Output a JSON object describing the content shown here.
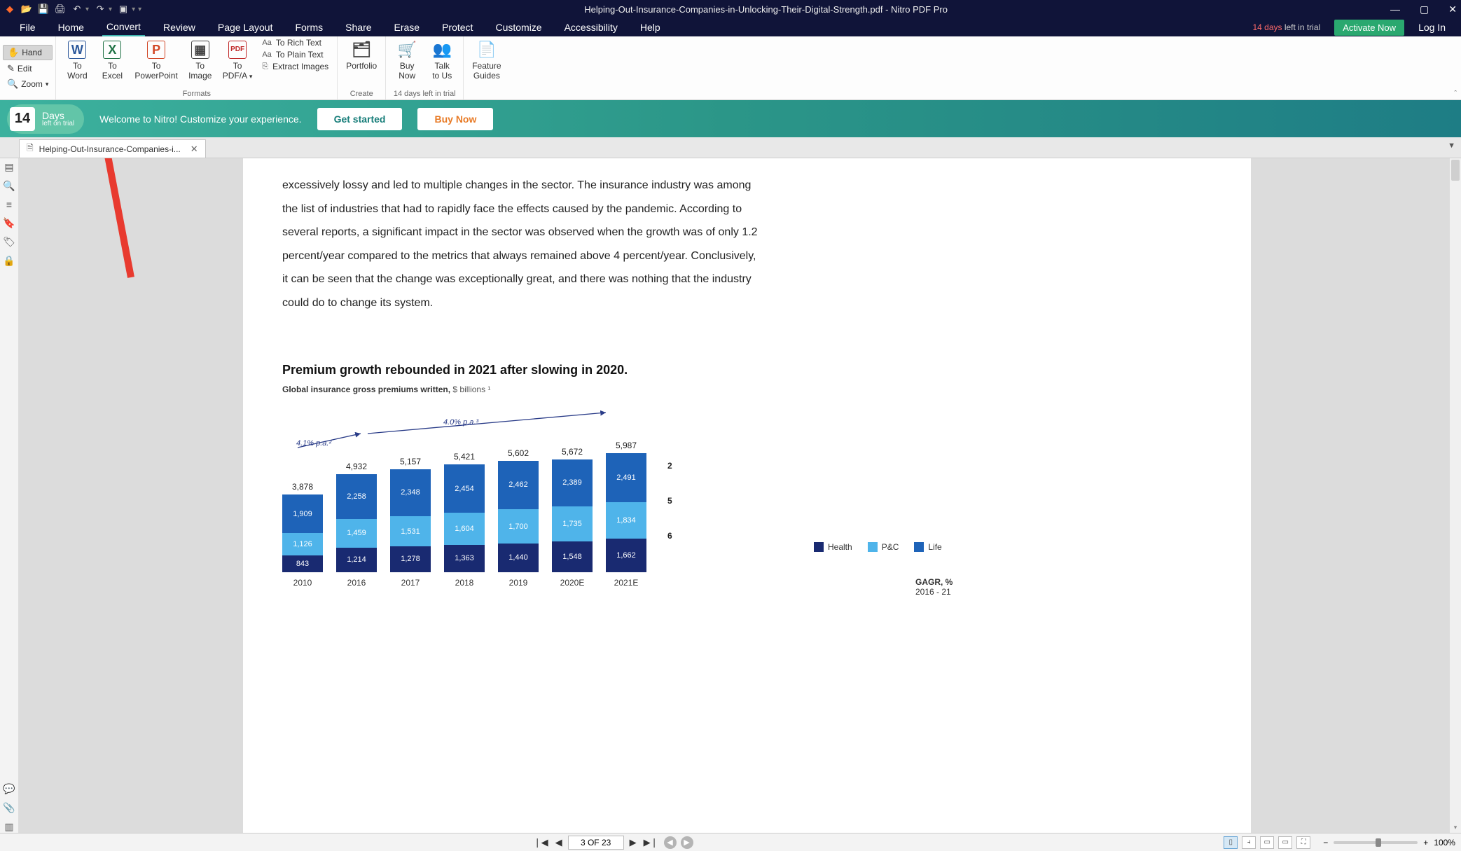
{
  "title_bar": {
    "doc_title": "Helping-Out-Insurance-Companies-in-Unlocking-Their-Digital-Strength.pdf - Nitro PDF Pro"
  },
  "menu": {
    "items": [
      "File",
      "Home",
      "Convert",
      "Review",
      "Page Layout",
      "Forms",
      "Share",
      "Erase",
      "Protect",
      "Customize",
      "Accessibility",
      "Help"
    ],
    "active": "Convert",
    "trial_days": "14 days",
    "trial_suffix": " left in trial",
    "activate": "Activate Now",
    "login": "Log In"
  },
  "ribbon": {
    "tools": {
      "hand": "Hand",
      "edit": "Edit",
      "zoom": "Zoom"
    },
    "convert": {
      "to_word": "To\nWord",
      "to_excel": "To\nExcel",
      "to_ppt": "To\nPowerPoint",
      "to_image": "To\nImage",
      "to_pdfa": "To\nPDF/A",
      "caption": "Formats",
      "rich": "To Rich Text",
      "plain": "To Plain Text",
      "extract": "Extract Images"
    },
    "create": {
      "portfolio": "Portfolio",
      "caption": "Create"
    },
    "trial_group": {
      "buy": "Buy\nNow",
      "talk": "Talk\nto Us",
      "caption": "14 days left in trial"
    },
    "guides": {
      "feature": "Feature\nGuides"
    }
  },
  "banner": {
    "days_num": "14",
    "days_label": "Days",
    "days_sub": "left on trial",
    "message": "Welcome to Nitro! Customize your experience.",
    "get_started": "Get started",
    "buy_now": "Buy Now"
  },
  "doc_tab": {
    "label": "Helping-Out-Insurance-Companies-i..."
  },
  "page_body": "excessively lossy and led to multiple changes in the sector. The insurance industry was among the list of industries that had to rapidly face the effects caused by the pandemic. According to several reports, a significant impact in the sector was observed when the growth was of only 1.2 percent/year compared to the metrics that always remained above 4 percent/year. Conclusively, it can be seen that the change was exceptionally great, and there was nothing that the industry could do to change its system.",
  "chart_title": "Premium growth rebounded in 2021 after slowing in 2020.",
  "chart_subtitle_a": "Global insurance gross premiums written,",
  "chart_subtitle_b": " $ billions ¹",
  "legend": {
    "health": "Health",
    "pc": "P&C",
    "life": "Life"
  },
  "gagr_label": "GAGR, %",
  "gagr_years": "2016 - 21",
  "growth1": "4.1% p.a.²",
  "growth2": "4.0% p.a.³",
  "chart_data": {
    "type": "bar",
    "stacked": true,
    "title": "Premium growth rebounded in 2021 after slowing in 2020.",
    "subtitle": "Global insurance gross premiums written, $ billions",
    "categories": [
      "2010",
      "2016",
      "2017",
      "2018",
      "2019",
      "2020E",
      "2021E"
    ],
    "series": [
      {
        "name": "Health",
        "color": "#192a71",
        "values": [
          843,
          1214,
          1278,
          1363,
          1440,
          1548,
          1662
        ],
        "gagr": 6
      },
      {
        "name": "P&C",
        "color": "#4fb4ea",
        "values": [
          1126,
          1459,
          1531,
          1604,
          1700,
          1735,
          1834
        ],
        "gagr": 5
      },
      {
        "name": "Life",
        "color": "#1e63b8",
        "values": [
          1909,
          2258,
          2348,
          2454,
          2462,
          2389,
          2491
        ],
        "gagr": 2
      }
    ],
    "totals": [
      3878,
      4932,
      5157,
      5421,
      5602,
      5672,
      5987
    ],
    "growth_annotations": [
      "4.1% p.a.",
      "4.0% p.a."
    ],
    "ylabel": "$ billions"
  },
  "status": {
    "page_of": "3 OF 23",
    "zoom": "100%"
  }
}
